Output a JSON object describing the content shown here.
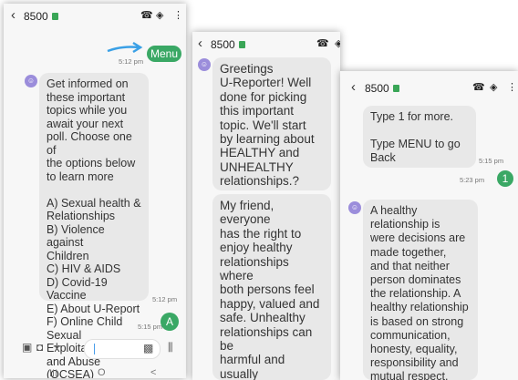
{
  "conversation": {
    "contact": "8500",
    "back_icon": "back-arrow-icon",
    "call_icon": "phone-icon",
    "shield_icon": "shield-icon",
    "menu_icon": "more-vert-icon",
    "accent_color": "#3aa865"
  },
  "screen1": {
    "out_menu": {
      "text": "Menu",
      "time": "5:12 pm"
    },
    "msg": {
      "text": "Get informed on\nthese important\ntopics while you\nawait your next\npoll. Choose one of\nthe options below\nto learn more\n\nA) Sexual health &\nRelationships\nB) Violence against\nChildren\nC) HIV & AIDS\nD) Covid-19 Vaccine\nE) About U-Report\nF) Online Child\nSexual Exploitation\nand Abuse (OCSEA)",
      "time": "5:12 pm"
    },
    "out_a": {
      "text": "A",
      "time": "5:15 pm"
    },
    "input": {
      "value": ""
    },
    "nav": {
      "recent": "III",
      "home": "O",
      "back": "<"
    }
  },
  "screen2": {
    "msg1": "Greetings\nU-Reporter! Well\ndone for picking\nthis important\ntopic. We'll start\nby learning about\nHEALTHY and\nUNHEALTHY\nrelationships.?",
    "msg2": "My friend, everyone\nhas the right to\nenjoy healthy\nrelationships where\nboth persons feel\nhappy, valued and\nsafe. Unhealthy\nrelationships can be\nharmful and usually\none or both of the\npersons involved in\nthe relationship are\nunhappy."
  },
  "screen3": {
    "msg_top": {
      "text": "Type 1 for more.\n\nType MENU to go\nBack",
      "time": "5:15 pm"
    },
    "out_1": {
      "text": "1",
      "time": "5:23 pm"
    },
    "msg": "A healthy\nrelationship is\nwere decisions are\nmade together,\nand that neither\nperson dominates\nthe relationship. A\nhealthy relationship\nis based on strong\ncommunication,\nhonesty, equality,\nresponsibility and\nmutual respect."
  }
}
